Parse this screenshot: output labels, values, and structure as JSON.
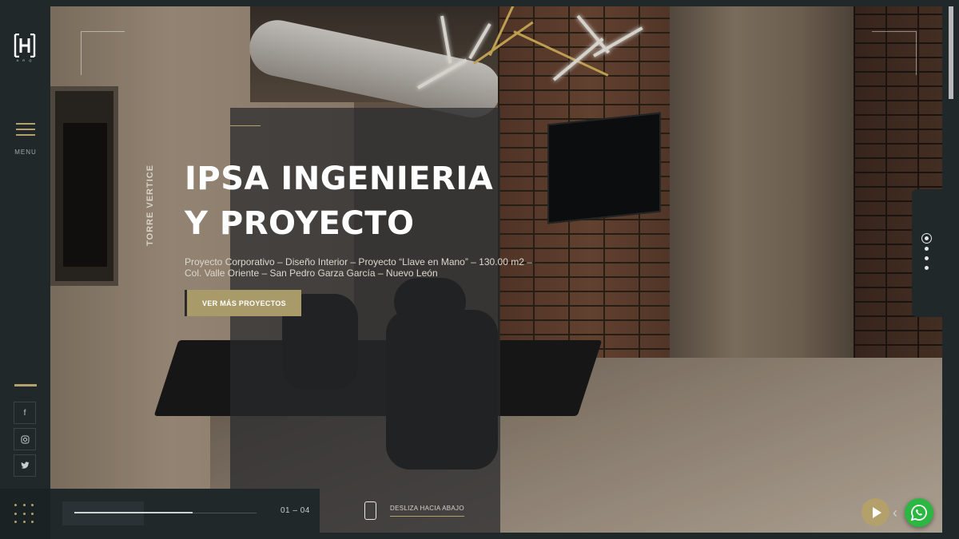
{
  "brand": {
    "logo_letter": "H",
    "logo_sub": "A R Q"
  },
  "sidebar": {
    "menu_label": "MENU",
    "social": [
      {
        "icon": "facebook-icon",
        "glyph": "f"
      },
      {
        "icon": "instagram-icon",
        "glyph": "◎"
      },
      {
        "icon": "twitter-icon",
        "glyph": "🐦"
      }
    ]
  },
  "hero": {
    "vertical_label": "TORRE VERTICE",
    "title_line1": "IPSA INGENIERIA",
    "title_line2": "Y PROYECTO",
    "description": "Proyecto Corporativo – Diseño Interior – Proyecto “Llave en Mano” – 130.00 m2 – Col. Valle Oriente – San Pedro Garza García – Nuevo León",
    "cta_label": "VER MÁS PROYECTOS"
  },
  "slider": {
    "counter": "01 – 04",
    "progress": 0.65,
    "scroll_hint": "DESLIZA HACIA ABAJO"
  },
  "colors": {
    "accent": "#b4a06a",
    "dark": "#20282a",
    "whatsapp": "#2bb741"
  }
}
